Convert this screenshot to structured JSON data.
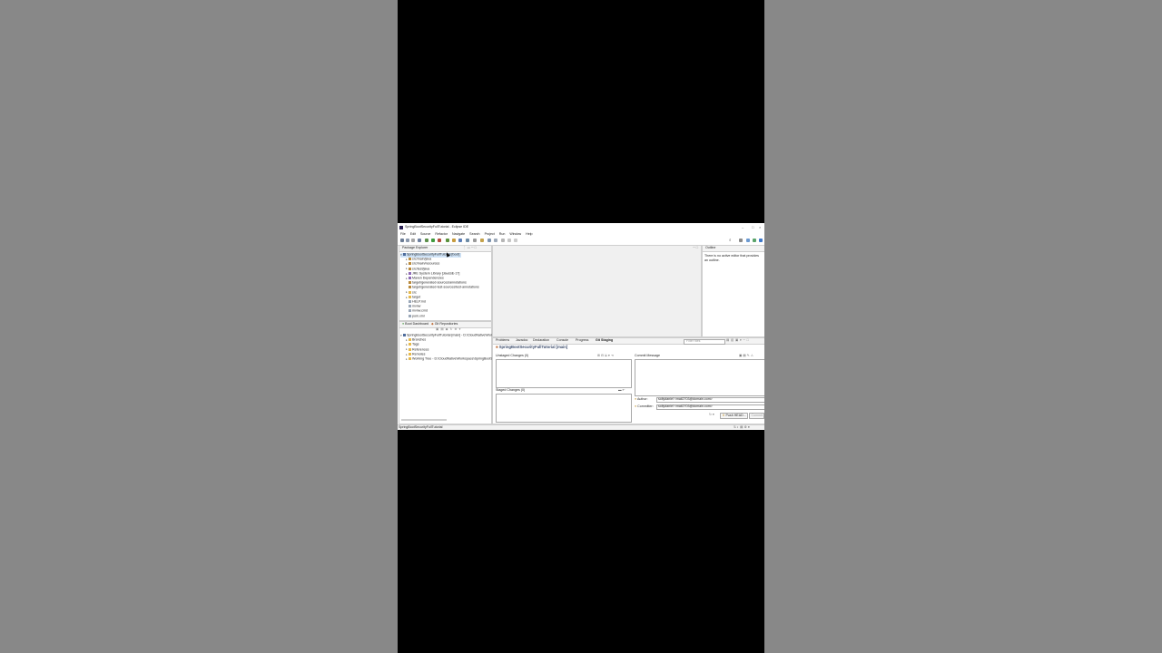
{
  "window": {
    "title": "SpringBootSecurityFullTutorial - Eclipse IDE"
  },
  "menu": [
    "File",
    "Edit",
    "Source",
    "Refactor",
    "Navigate",
    "Search",
    "Project",
    "Run",
    "Window",
    "Help"
  ],
  "package_explorer": {
    "tab": "Package Explorer",
    "rows": [
      {
        "twisty": "▾",
        "icon": "project-icon",
        "label": "SpringBootSecurityFullTutorial [boot]",
        "selected": true
      },
      {
        "twisty": "▸",
        "icon": "package-folder-icon",
        "label": "src/main/java"
      },
      {
        "twisty": "▸",
        "icon": "package-folder-icon",
        "label": "src/main/resources"
      },
      {
        "twisty": "▸",
        "icon": "package-folder-icon",
        "label": "src/test/java"
      },
      {
        "twisty": "▸",
        "icon": "library-icon",
        "label": "JRE System Library [JavaSE-17]"
      },
      {
        "twisty": "▸",
        "icon": "library-icon",
        "label": "Maven Dependencies"
      },
      {
        "twisty": "",
        "icon": "package-folder-icon",
        "label": "target/generated-sources/annotations"
      },
      {
        "twisty": "",
        "icon": "package-folder-icon",
        "label": "target/generated-test-sources/test-annotations"
      },
      {
        "twisty": "▸",
        "icon": "folder-icon",
        "label": "src"
      },
      {
        "twisty": "▸",
        "icon": "folder-icon",
        "label": "target"
      },
      {
        "twisty": "",
        "icon": "file-icon",
        "label": "HELP.md"
      },
      {
        "twisty": "",
        "icon": "file-icon",
        "label": "mvnw"
      },
      {
        "twisty": "",
        "icon": "file-icon",
        "label": "mvnw.cmd"
      },
      {
        "twisty": "",
        "icon": "file-icon",
        "label": "pom.xml"
      }
    ]
  },
  "git_repos": {
    "tabs": [
      "Boot Dashboard",
      "Git Repositories"
    ],
    "rows": [
      {
        "twisty": "▾",
        "icon": "repo-icon",
        "label": "SpringBootSecurityFullTutorial [main] - D:\\CloudNative\\Workspace\\SpringBootSecurityFullTutorial\\.git"
      },
      {
        "twisty": "▸",
        "icon": "folder-icon",
        "label": "Branches"
      },
      {
        "twisty": "▸",
        "icon": "folder-icon",
        "label": "Tags"
      },
      {
        "twisty": "▸",
        "icon": "folder-icon",
        "label": "References"
      },
      {
        "twisty": "▸",
        "icon": "folder-icon",
        "label": "Remotes"
      },
      {
        "twisty": "▸",
        "icon": "folder-icon",
        "label": "Working Tree - D:\\CloudNative\\Workspace\\SpringBootSecurityFullTutorial"
      }
    ]
  },
  "outline": {
    "tab": "Outline",
    "message": "There is no active editor that provides an outline."
  },
  "bottom_tabs": [
    "Problems",
    "Javadoc",
    "Declaration",
    "Console",
    "Progress",
    "Git Staging"
  ],
  "filter_placeholder": "Filter files",
  "git_staging": {
    "title": "SpringBootSecurityFullTutorial [main]",
    "unstaged_label": "Unstaged Changes (0)",
    "staged_label": "Staged Changes (0)",
    "commit_message_label": "Commit Message",
    "author_label": "Author:",
    "author_value": "sollydaniel <mail2703@domain.com>",
    "committer_label": "Committer:",
    "committer_value": "sollydaniel <mail2703@domain.com>",
    "push_button": "Push HEAD...",
    "commit_button": "Commit"
  },
  "status_bar": {
    "text": "SpringBootSecurityFullTutorial"
  }
}
